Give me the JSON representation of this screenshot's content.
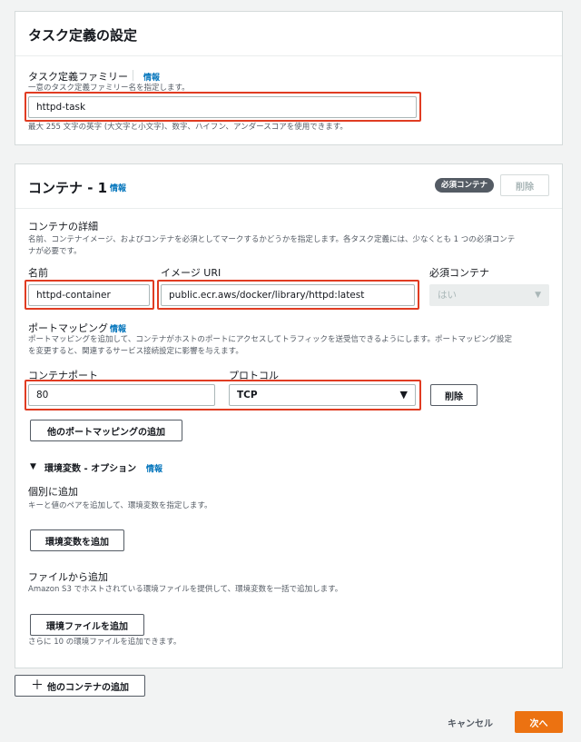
{
  "task_section": {
    "title": "タスク定義の設定",
    "family_label": "タスク定義ファミリー",
    "info": "情報",
    "family_desc": "一意のタスク定義ファミリー名を指定します。",
    "family_value": "httpd-task",
    "family_hint": "最大 255 文字の英字 (大文字と小文字)、数字、ハイフン、アンダースコアを使用できます。"
  },
  "container_section": {
    "title": "コンテナ - 1",
    "info": "情報",
    "required_badge": "必須コンテナ",
    "delete_button": "削除",
    "details_title": "コンテナの詳細",
    "details_desc_1": "名前、コンテナイメージ、およびコンテナを必須としてマークするかどうかを指定します。各タスク定義には、少なくとも 1 つの必須コンテ",
    "details_desc_2": "ナが必要です。",
    "name_label": "名前",
    "name_value": "httpd-container",
    "image_label": "イメージ URI",
    "image_value": "public.ecr.aws/docker/library/httpd:latest",
    "essential_label": "必須コンテナ",
    "essential_value": "はい",
    "port_title": "ポートマッピング",
    "port_info": "情報",
    "port_desc_1": "ポートマッピングを追加して、コンテナがホストのポートにアクセスしてトラフィックを送受信できるようにします。ポートマッピング設定",
    "port_desc_2": "を変更すると、関連するサービス接続設定に影響を与えます。",
    "container_port_label": "コンテナポート",
    "container_port_value": "80",
    "protocol_label": "プロトコル",
    "protocol_value": "TCP",
    "port_delete_button": "削除",
    "add_port_button": "他のポートマッピングの追加",
    "env_title": "環境変数 - オプション",
    "env_info": "情報",
    "individual_title": "個別に追加",
    "individual_desc": "キーと値のペアを追加して、環境変数を指定します。",
    "add_env_button": "環境変数を追加",
    "file_title": "ファイルから追加",
    "file_desc": "Amazon S3 でホストされている環境ファイルを提供して、環境変数を一括で追加します。",
    "add_env_file_button": "環境ファイルを追加",
    "env_file_hint": "さらに 10 の環境ファイルを追加できます。"
  },
  "footer": {
    "add_container_button": "他のコンテナの追加",
    "cancel_button": "キャンセル",
    "next_button": "次へ"
  },
  "colors": {
    "primary": "#ec7211",
    "link": "#0073bb",
    "highlight": "#e03c22"
  }
}
